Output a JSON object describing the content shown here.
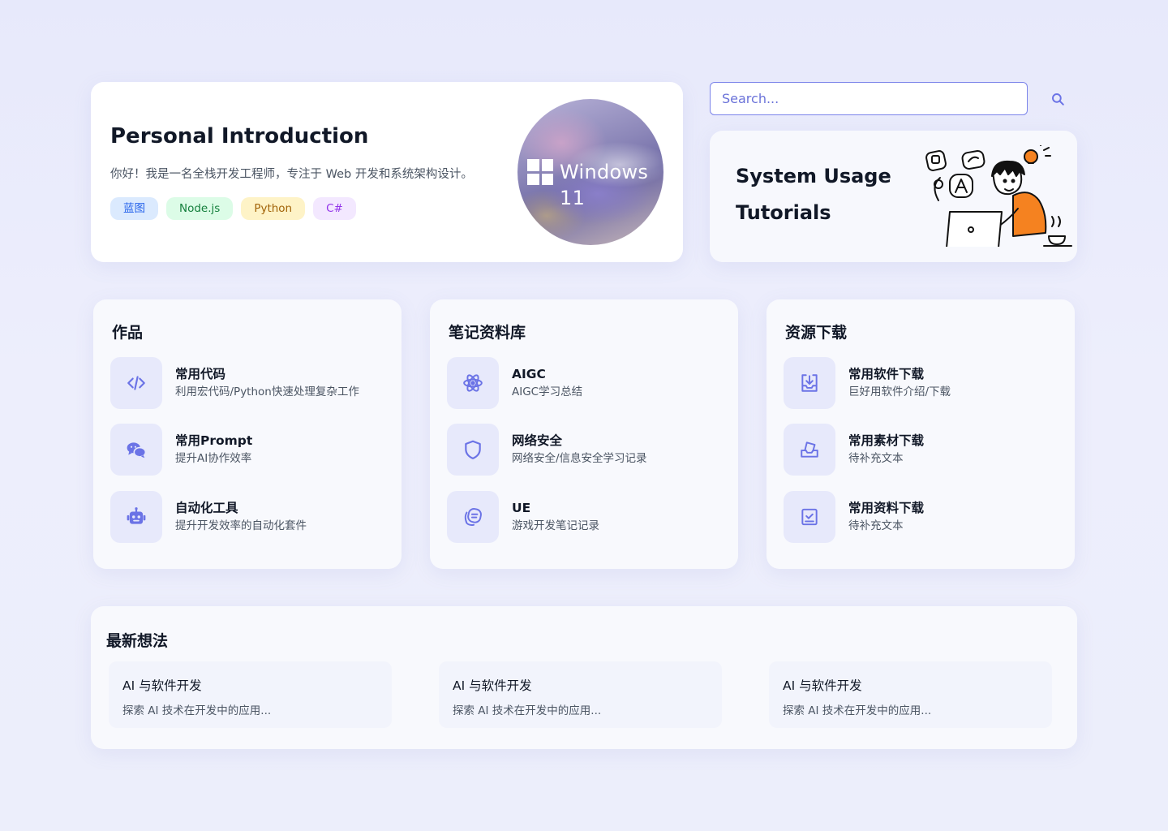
{
  "intro": {
    "title": "Personal Introduction",
    "description": "你好！我是一名全栈开发工程师，专注于 Web 开发和系统架构设计。",
    "tags": [
      "蓝图",
      "Node.js",
      "Python",
      "C#"
    ],
    "badge_text": "Windows 11"
  },
  "search": {
    "placeholder": "Search..."
  },
  "tutorial": {
    "line1": "System Usage",
    "line2": "Tutorials"
  },
  "works": {
    "title": "作品",
    "items": [
      {
        "name": "常用代码",
        "desc": "利用宏代码/Python快速处理复杂工作",
        "icon": "code-icon"
      },
      {
        "name": "常用Prompt",
        "desc": "提升AI协作效率",
        "icon": "chat-icon"
      },
      {
        "name": "自动化工具",
        "desc": "提升开发效率的自动化套件",
        "icon": "robot-icon"
      }
    ]
  },
  "notes": {
    "title": "笔记资料库",
    "items": [
      {
        "name": "AIGC",
        "desc": "AIGC学习总结",
        "icon": "atom-icon"
      },
      {
        "name": "网络安全",
        "desc": "网络安全/信息安全学习记录",
        "icon": "shield-icon"
      },
      {
        "name": "UE",
        "desc": "游戏开发笔记记录",
        "icon": "notes-icon"
      }
    ]
  },
  "downloads": {
    "title": "资源下载",
    "items": [
      {
        "name": "常用软件下载",
        "desc": "巨好用软件介绍/下载",
        "icon": "download-tray-icon"
      },
      {
        "name": "常用素材下载",
        "desc": "待补充文本",
        "icon": "inbox-icon"
      },
      {
        "name": "常用资料下载",
        "desc": "待补充文本",
        "icon": "checkbox-icon"
      }
    ]
  },
  "thoughts": {
    "title": "最新想法",
    "items": [
      {
        "title": "AI 与软件开发",
        "desc": "探索 AI 技术在开发中的应用..."
      },
      {
        "title": "AI 与软件开发",
        "desc": "探索 AI 技术在开发中的应用..."
      },
      {
        "title": "AI 与软件开发",
        "desc": "探索 AI 技术在开发中的应用..."
      }
    ]
  },
  "colors": {
    "accent": "#6b73e6",
    "icon_bg": "#e7e9fb",
    "page_bg": "#e9ebfb"
  }
}
